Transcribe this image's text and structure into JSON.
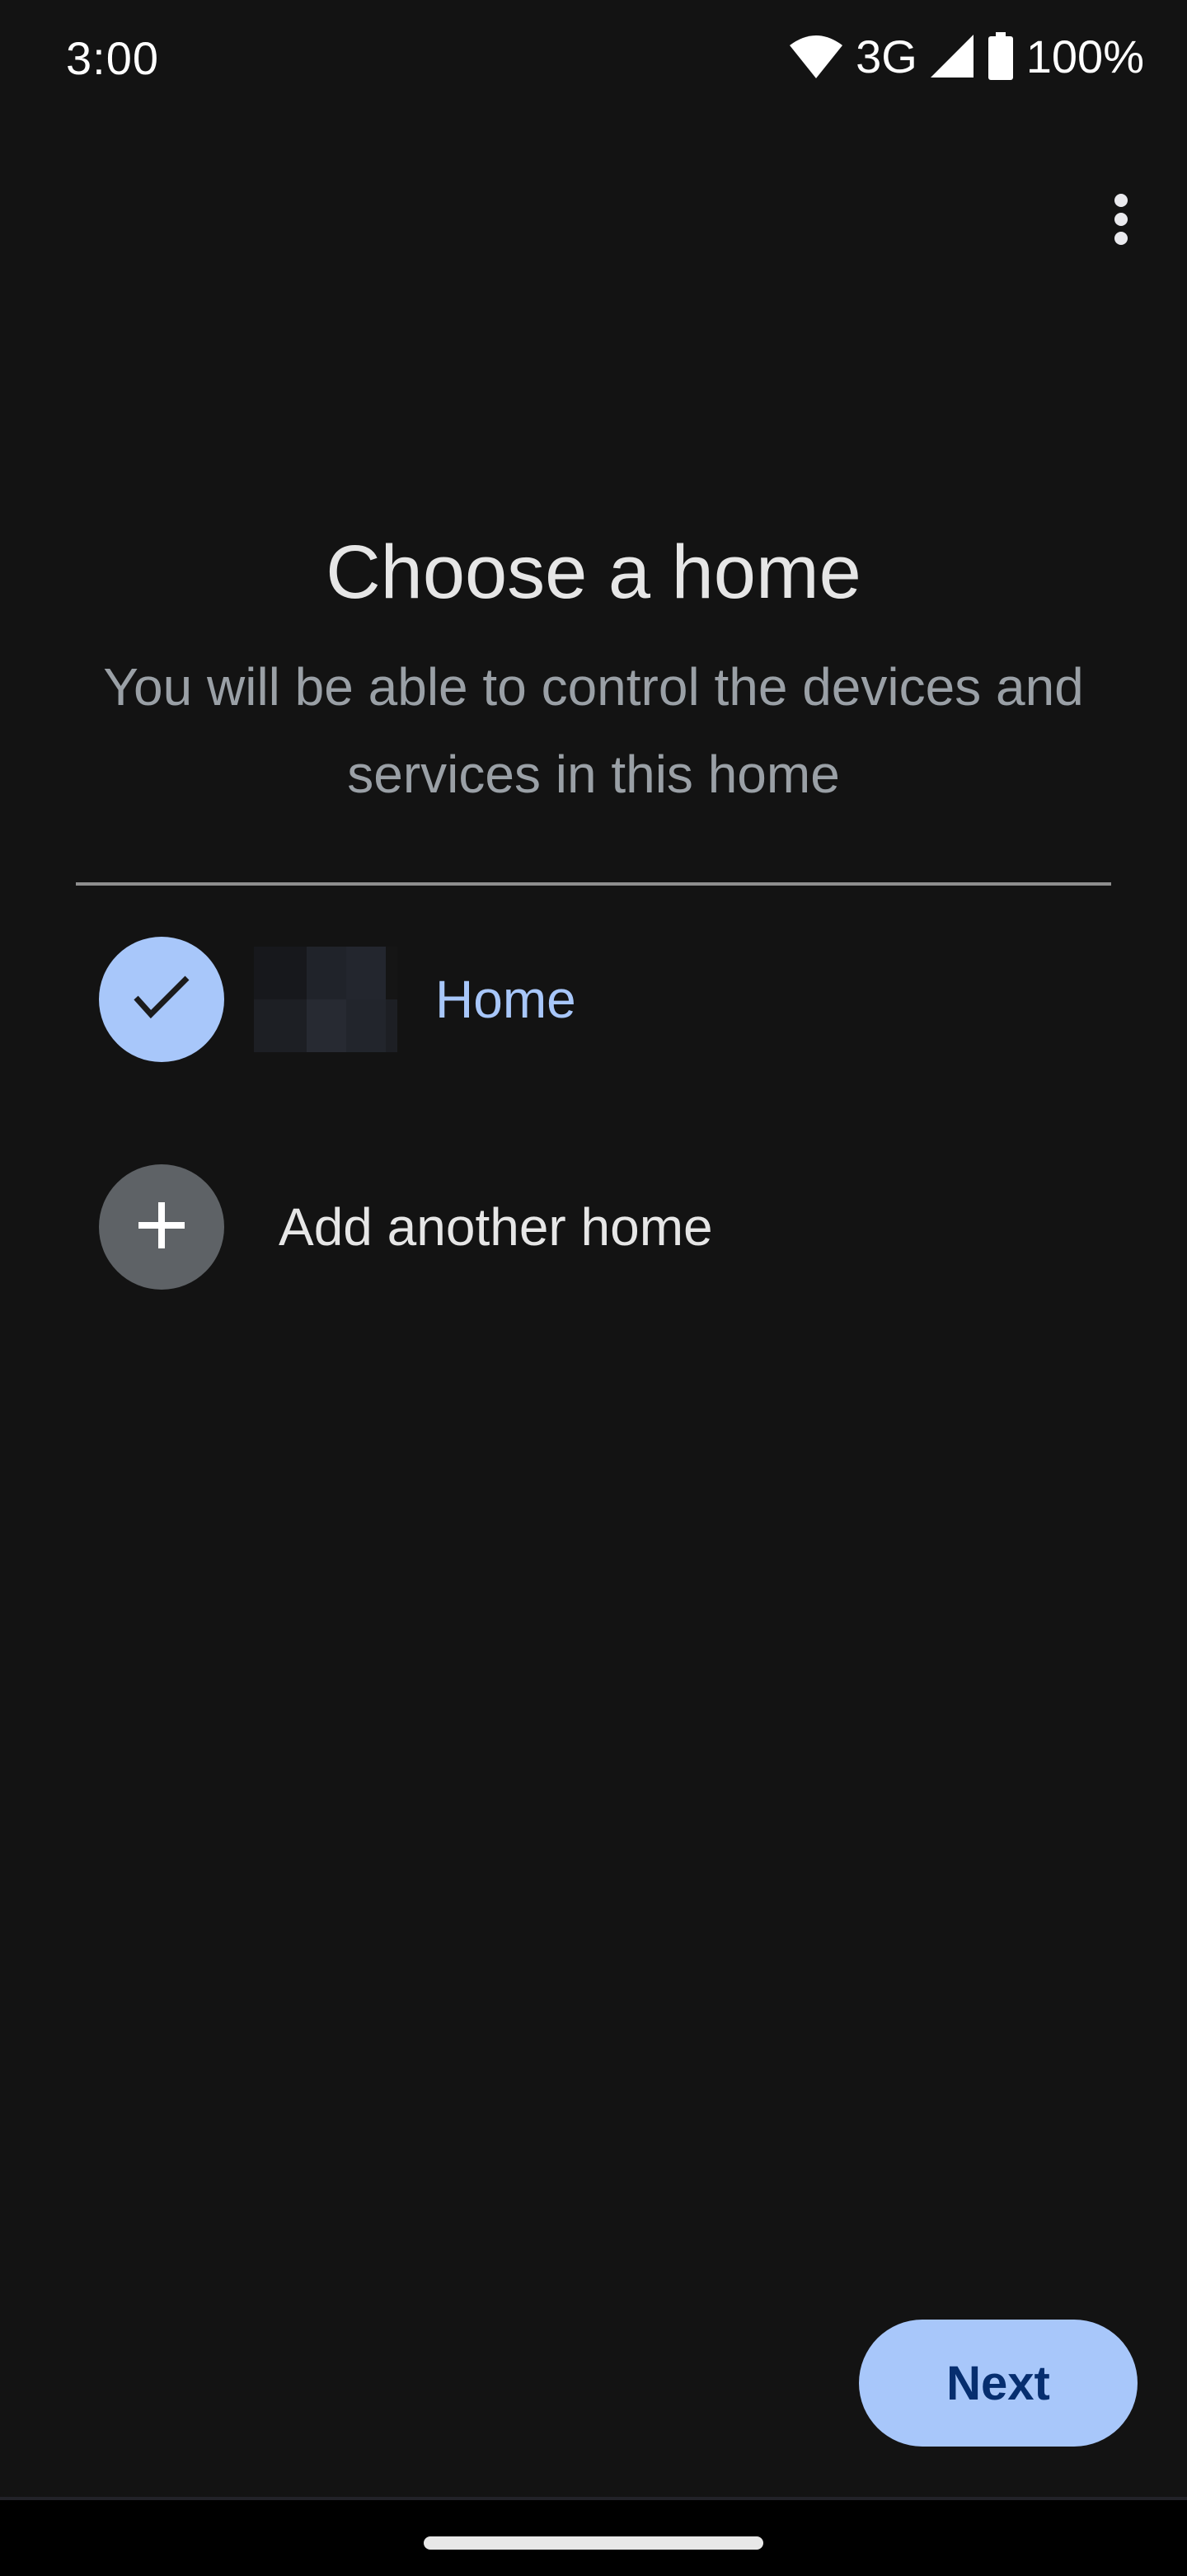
{
  "status_bar": {
    "time": "3:00",
    "network": "3G",
    "battery": "100%",
    "icons": [
      "wifi-icon",
      "cell-signal-icon",
      "battery-icon"
    ]
  },
  "toolbar": {
    "more_icon": "more-vert-icon"
  },
  "page": {
    "title": "Choose a home",
    "subtitle": "You will be able to control the devices and services in this home"
  },
  "homes": [
    {
      "label": "Home",
      "selected": true,
      "icon": "check-icon"
    }
  ],
  "add_home": {
    "label": "Add another home",
    "icon": "plus-icon"
  },
  "actions": {
    "next_label": "Next"
  },
  "colors": {
    "background": "#131313",
    "accent": "#a8c7fa",
    "accent_text": "#062e6f",
    "subtitle": "#9aa0a6",
    "add_circle": "#5e6266"
  }
}
